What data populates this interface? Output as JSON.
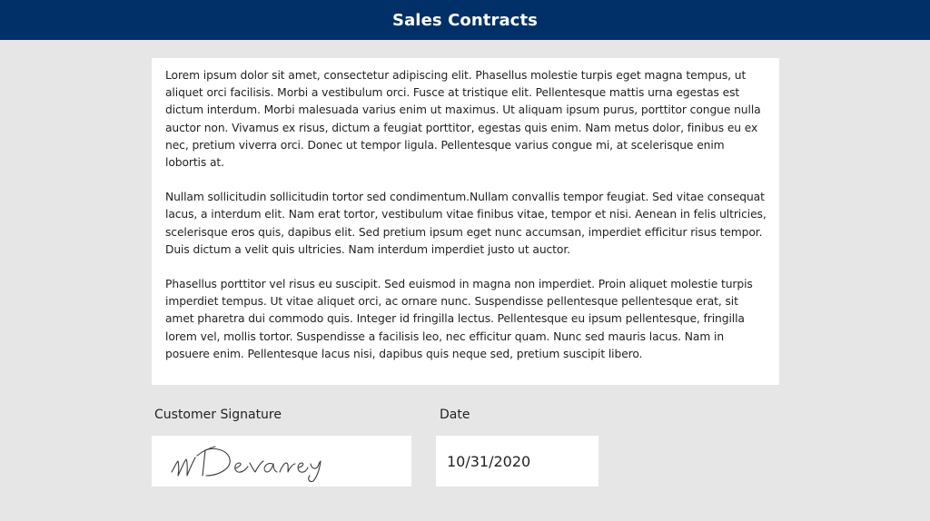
{
  "header": {
    "title": "Sales Contracts",
    "background_color": "#013068"
  },
  "contract": {
    "paragraphs": [
      "Lorem ipsum dolor sit amet, consectetur adipiscing elit. Phasellus molestie turpis eget magna tempus, ut aliquet orci facilisis. Morbi a vestibulum orci. Fusce at tristique elit. Pellentesque mattis urna egestas est dictum interdum. Morbi malesuada varius enim ut maximus. Ut aliquam ipsum purus, porttitor congue nulla auctor non. Vivamus ex risus, dictum a feugiat porttitor, egestas quis enim. Nam metus dolor, finibus eu ex nec, pretium viverra orci. Donec ut tempor ligula. Pellentesque varius congue mi, at scelerisque enim lobortis at.",
      "Nullam sollicitudin sollicitudin tortor sed condimentum.Nullam convallis tempor feugiat. Sed vitae consequat lacus, a interdum elit. Nam erat tortor, vestibulum vitae finibus vitae, tempor et nisi. Aenean in felis ultricies, scelerisque eros quis, dapibus elit. Sed pretium ipsum eget nunc accumsan, imperdiet efficitur risus tempor. Duis dictum a velit quis ultricies. Nam interdum imperdiet justo ut auctor.",
      "Phasellus porttitor vel risus eu suscipit. Sed euismod in magna non imperdiet. Proin aliquet molestie turpis imperdiet tempus. Ut vitae aliquet orci, ac ornare nunc. Suspendisse pellentesque pellentesque erat, sit amet pharetra dui commodo quis. Integer id fringilla lectus. Pellentesque eu ipsum pellentesque, fringilla lorem vel, mollis tortor. Suspendisse a facilisis leo, nec efficitur quam. Nunc sed mauris lacus. Nam in posuere enim. Pellentesque lacus nisi, dapibus quis neque sed, pretium suscipit libero."
    ]
  },
  "signature": {
    "label": "Customer Signature",
    "signed_text": "M Devaney"
  },
  "date": {
    "label": "Date",
    "value": "10/31/2020"
  }
}
